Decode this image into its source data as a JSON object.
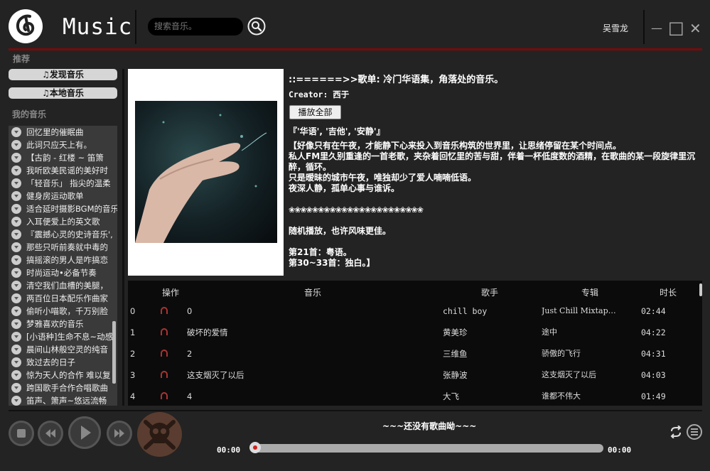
{
  "header": {
    "title": "Music",
    "search_placeholder": "搜索音乐。",
    "username": "吴雪龙",
    "minimize": "—",
    "maximize": "□",
    "close": "✕"
  },
  "sidebar": {
    "recommend_title": "推荐",
    "discover_label": "♫发现音乐",
    "local_label": "♫本地音乐",
    "my_music_title": "我的音乐",
    "playlists": [
      "回忆里的催眠曲",
      "此词只应天上有。",
      "【古韵 - 红楼 ~ 笛箫",
      "我听欧美民谣的美好时",
      "「轻音乐」 指尖的温柔",
      "健身房运动歌单",
      "适合延时摄影BGM的音乐",
      "入耳便爱上的英文歌",
      "『震撼心灵的史诗音乐',",
      "那些只听前奏就中毒的",
      "搞摇滚的男人是咋搞恋",
      "时尚运动•必备节奏",
      "清空我们血槽的美腿，",
      "两百位日本配乐作曲家",
      "偷听小喵歌，千万别脸",
      "梦雅喜欢的音乐",
      "[小语种]生命不息~动感",
      "晨间山林般空灵的纯音",
      "致过去的日子",
      "惊为天人的合作 难以复",
      "跨国歌手合作合唱歌曲",
      "笛声、箫声~悠远流畅"
    ]
  },
  "playlist_info": {
    "title": "::======>>歌单: 冷门华语集，角落处的音乐。",
    "creator": "Creator: 西于",
    "play_all": "播放全部",
    "tags": "『'华语', '吉他', '安静'』",
    "desc_lines": [
      "【好像只有在午夜，才能静下心来投入到音乐构筑的世界里，让思绪停留在某个时间点。",
      "私人FM里久别重逢的一首老歌，夹杂着回忆里的苦与甜，伴着一杯低度数的酒精，在歌曲的某一段旋律里沉醉，循环。",
      "只是暧昧的城市午夜，唯独却少了爱人喃喃低语。",
      "夜深人静，孤单心事与谁诉。",
      "",
      "❀❀❀❀❀❀❀❀❀❀❀❀❀❀❀❀❀❀❀❀❀❀❀",
      "",
      "随机播放，也许风味更佳。",
      "",
      "第21首：粤语。",
      "第30~33首：独白。】"
    ]
  },
  "songs_table": {
    "headers": [
      "操作",
      "音乐",
      "歌手",
      "专辑",
      "时长"
    ],
    "rows": [
      {
        "idx": "0",
        "name": "0",
        "artist": "chill boy",
        "album": "Just Chill Mixtap…",
        "duration": "02:44"
      },
      {
        "idx": "1",
        "name": "破坏的爱情",
        "artist": "黄美珍",
        "album": "途中",
        "duration": "04:22"
      },
      {
        "idx": "2",
        "name": "2",
        "artist": "三维鱼",
        "album": "骄傲的飞行",
        "duration": "04:31"
      },
      {
        "idx": "3",
        "name": "这支烟灭了以后",
        "artist": "张静波",
        "album": "这支烟灭了以后",
        "duration": "04:03"
      },
      {
        "idx": "4",
        "name": "4",
        "artist": "大飞",
        "album": "谁都不伟大",
        "duration": "01:49"
      }
    ]
  },
  "player": {
    "status": "~~~还没有歌曲呦~~~",
    "time_current": "00:00",
    "time_total": "00:00",
    "progress": 0
  },
  "colors": {
    "accent": "#7a0a0a",
    "background": "#232323"
  }
}
